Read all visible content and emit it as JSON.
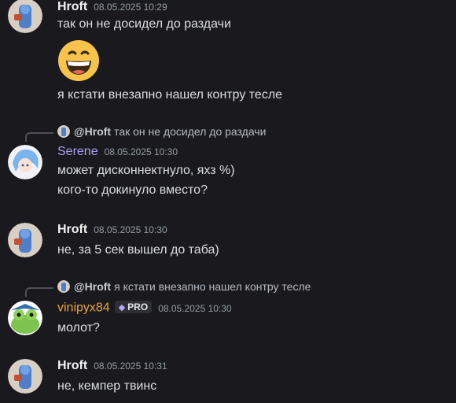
{
  "messages": [
    {
      "author": "Hroft",
      "time": "08.05.2025 10:29",
      "lines": [
        "так он не досидел до раздачи"
      ],
      "emoji": "grinning-face-emoji",
      "extra": "я кстати внезапно нашел контру тесле"
    },
    {
      "reply_to": "@Hroft",
      "reply_text": "так он не досидел до раздачи",
      "author": "Serene",
      "time": "08.05.2025 10:30",
      "lines": [
        "может дисконнектнуло, яхз %)",
        "кого-то докинуло вместо?"
      ]
    },
    {
      "author": "Hroft",
      "time": "08.05.2025 10:30",
      "lines": [
        "не, за 5 сек вышел до таба)"
      ]
    },
    {
      "reply_to": "@Hroft",
      "reply_text": "я кстати внезапно нашел контру тесле",
      "author": "vinipyx84",
      "badge": "PRO",
      "time": "08.05.2025 10:30",
      "lines": [
        "молот?"
      ]
    },
    {
      "author": "Hroft",
      "time": "08.05.2025 10:31",
      "lines": [
        "не, кемпер твинс"
      ]
    }
  ],
  "colors": {
    "background": "#1a1a1e",
    "serene": "#a8a0f0",
    "vinipyx84": "#e8a13a",
    "text": "#dbdee1",
    "timestamp": "#949ba4"
  }
}
